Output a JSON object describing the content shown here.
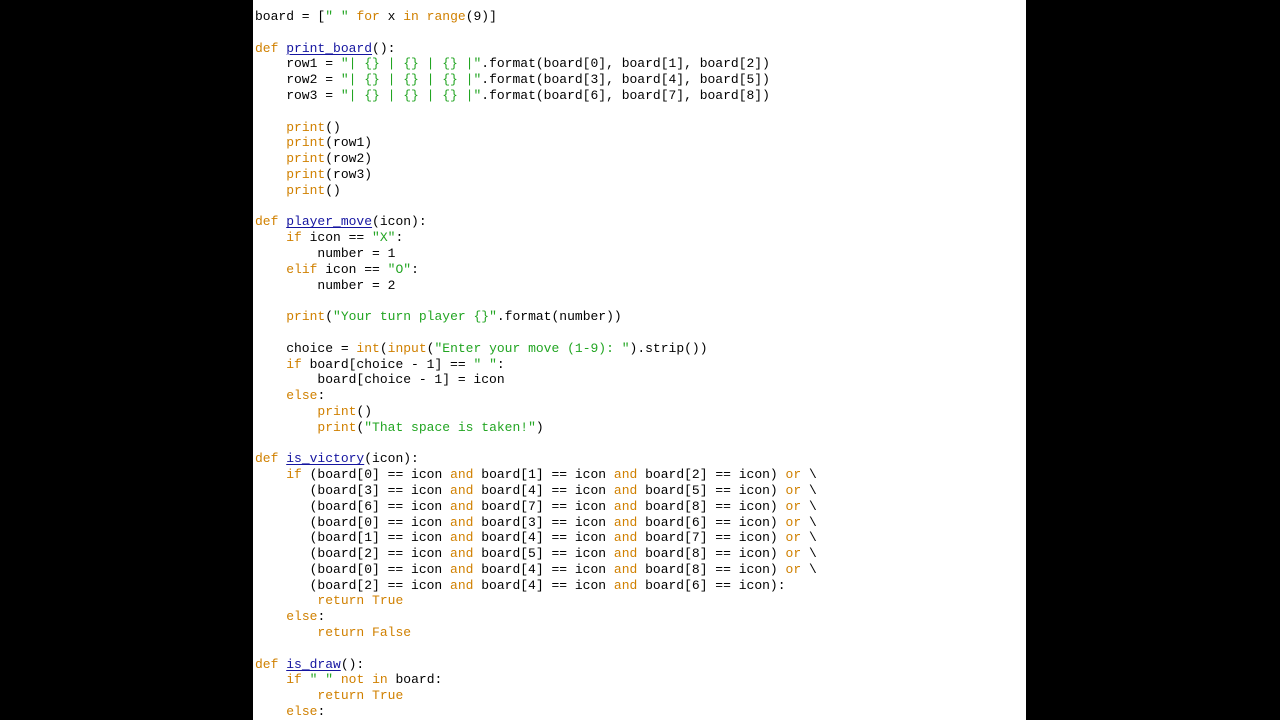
{
  "colors": {
    "background": "#000000",
    "editor_background": "#ffffff",
    "text": "#000000",
    "keyword": "#d08000",
    "string": "#22a522",
    "function_name": "#1515a0"
  },
  "editor": {
    "lines": [
      [
        {
          "t": "board = [",
          "c": "p"
        },
        {
          "t": "\" \"",
          "c": "s"
        },
        {
          "t": " ",
          "c": "p"
        },
        {
          "t": "for",
          "c": "k"
        },
        {
          "t": " x ",
          "c": "p"
        },
        {
          "t": "in",
          "c": "k"
        },
        {
          "t": " ",
          "c": "p"
        },
        {
          "t": "range",
          "c": "k"
        },
        {
          "t": "(9)]",
          "c": "p"
        }
      ],
      [],
      [
        {
          "t": "def",
          "c": "k"
        },
        {
          "t": " ",
          "c": "p"
        },
        {
          "t": "print_board",
          "c": "f"
        },
        {
          "t": "():",
          "c": "p"
        }
      ],
      [
        {
          "t": "    row1 = ",
          "c": "p"
        },
        {
          "t": "\"| {} | {} | {} |\"",
          "c": "s"
        },
        {
          "t": ".format(board[0], board[1], board[2])",
          "c": "p"
        }
      ],
      [
        {
          "t": "    row2 = ",
          "c": "p"
        },
        {
          "t": "\"| {} | {} | {} |\"",
          "c": "s"
        },
        {
          "t": ".format(board[3], board[4], board[5])",
          "c": "p"
        }
      ],
      [
        {
          "t": "    row3 = ",
          "c": "p"
        },
        {
          "t": "\"| {} | {} | {} |\"",
          "c": "s"
        },
        {
          "t": ".format(board[6], board[7], board[8])",
          "c": "p"
        }
      ],
      [],
      [
        {
          "t": "    ",
          "c": "p"
        },
        {
          "t": "print",
          "c": "k"
        },
        {
          "t": "()",
          "c": "p"
        }
      ],
      [
        {
          "t": "    ",
          "c": "p"
        },
        {
          "t": "print",
          "c": "k"
        },
        {
          "t": "(row1)",
          "c": "p"
        }
      ],
      [
        {
          "t": "    ",
          "c": "p"
        },
        {
          "t": "print",
          "c": "k"
        },
        {
          "t": "(row2)",
          "c": "p"
        }
      ],
      [
        {
          "t": "    ",
          "c": "p"
        },
        {
          "t": "print",
          "c": "k"
        },
        {
          "t": "(row3)",
          "c": "p"
        }
      ],
      [
        {
          "t": "    ",
          "c": "p"
        },
        {
          "t": "print",
          "c": "k"
        },
        {
          "t": "()",
          "c": "p"
        }
      ],
      [],
      [
        {
          "t": "def",
          "c": "k"
        },
        {
          "t": " ",
          "c": "p"
        },
        {
          "t": "player_move",
          "c": "f"
        },
        {
          "t": "(icon):",
          "c": "p"
        }
      ],
      [
        {
          "t": "    ",
          "c": "p"
        },
        {
          "t": "if",
          "c": "k"
        },
        {
          "t": " icon == ",
          "c": "p"
        },
        {
          "t": "\"X\"",
          "c": "s"
        },
        {
          "t": ":",
          "c": "p"
        }
      ],
      [
        {
          "t": "        number = 1",
          "c": "p"
        }
      ],
      [
        {
          "t": "    ",
          "c": "p"
        },
        {
          "t": "elif",
          "c": "k"
        },
        {
          "t": " icon == ",
          "c": "p"
        },
        {
          "t": "\"O\"",
          "c": "s"
        },
        {
          "t": ":",
          "c": "p"
        }
      ],
      [
        {
          "t": "        number = 2",
          "c": "p"
        }
      ],
      [],
      [
        {
          "t": "    ",
          "c": "p"
        },
        {
          "t": "print",
          "c": "k"
        },
        {
          "t": "(",
          "c": "p"
        },
        {
          "t": "\"Your turn player {}\"",
          "c": "s"
        },
        {
          "t": ".format(number))",
          "c": "p"
        }
      ],
      [],
      [
        {
          "t": "    choice = ",
          "c": "p"
        },
        {
          "t": "int",
          "c": "k"
        },
        {
          "t": "(",
          "c": "p"
        },
        {
          "t": "input",
          "c": "k"
        },
        {
          "t": "(",
          "c": "p"
        },
        {
          "t": "\"Enter your move (1-9): \"",
          "c": "s"
        },
        {
          "t": ").strip())",
          "c": "p"
        }
      ],
      [
        {
          "t": "    ",
          "c": "p"
        },
        {
          "t": "if",
          "c": "k"
        },
        {
          "t": " board[choice - 1] == ",
          "c": "p"
        },
        {
          "t": "\" \"",
          "c": "s"
        },
        {
          "t": ":",
          "c": "p"
        }
      ],
      [
        {
          "t": "        board[choice - 1] = icon",
          "c": "p"
        }
      ],
      [
        {
          "t": "    ",
          "c": "p"
        },
        {
          "t": "else",
          "c": "k"
        },
        {
          "t": ":",
          "c": "p"
        }
      ],
      [
        {
          "t": "        ",
          "c": "p"
        },
        {
          "t": "print",
          "c": "k"
        },
        {
          "t": "()",
          "c": "p"
        }
      ],
      [
        {
          "t": "        ",
          "c": "p"
        },
        {
          "t": "print",
          "c": "k"
        },
        {
          "t": "(",
          "c": "p"
        },
        {
          "t": "\"That space is taken!\"",
          "c": "s"
        },
        {
          "t": ")",
          "c": "p"
        }
      ],
      [],
      [
        {
          "t": "def",
          "c": "k"
        },
        {
          "t": " ",
          "c": "p"
        },
        {
          "t": "is_victory",
          "c": "f"
        },
        {
          "t": "(icon):",
          "c": "p"
        }
      ],
      [
        {
          "t": "    ",
          "c": "p"
        },
        {
          "t": "if",
          "c": "k"
        },
        {
          "t": " (board[0] == icon ",
          "c": "p"
        },
        {
          "t": "and",
          "c": "k"
        },
        {
          "t": " board[1] == icon ",
          "c": "p"
        },
        {
          "t": "and",
          "c": "k"
        },
        {
          "t": " board[2] == icon) ",
          "c": "p"
        },
        {
          "t": "or",
          "c": "k"
        },
        {
          "t": " \\",
          "c": "p"
        }
      ],
      [
        {
          "t": "       (board[3] == icon ",
          "c": "p"
        },
        {
          "t": "and",
          "c": "k"
        },
        {
          "t": " board[4] == icon ",
          "c": "p"
        },
        {
          "t": "and",
          "c": "k"
        },
        {
          "t": " board[5] == icon) ",
          "c": "p"
        },
        {
          "t": "or",
          "c": "k"
        },
        {
          "t": " \\",
          "c": "p"
        }
      ],
      [
        {
          "t": "       (board[6] == icon ",
          "c": "p"
        },
        {
          "t": "and",
          "c": "k"
        },
        {
          "t": " board[7] == icon ",
          "c": "p"
        },
        {
          "t": "and",
          "c": "k"
        },
        {
          "t": " board[8] == icon) ",
          "c": "p"
        },
        {
          "t": "or",
          "c": "k"
        },
        {
          "t": " \\",
          "c": "p"
        }
      ],
      [
        {
          "t": "       (board[0] == icon ",
          "c": "p"
        },
        {
          "t": "and",
          "c": "k"
        },
        {
          "t": " board[3] == icon ",
          "c": "p"
        },
        {
          "t": "and",
          "c": "k"
        },
        {
          "t": " board[6] == icon) ",
          "c": "p"
        },
        {
          "t": "or",
          "c": "k"
        },
        {
          "t": " \\",
          "c": "p"
        }
      ],
      [
        {
          "t": "       (board[1] == icon ",
          "c": "p"
        },
        {
          "t": "and",
          "c": "k"
        },
        {
          "t": " board[4] == icon ",
          "c": "p"
        },
        {
          "t": "and",
          "c": "k"
        },
        {
          "t": " board[7] == icon) ",
          "c": "p"
        },
        {
          "t": "or",
          "c": "k"
        },
        {
          "t": " \\",
          "c": "p"
        }
      ],
      [
        {
          "t": "       (board[2] == icon ",
          "c": "p"
        },
        {
          "t": "and",
          "c": "k"
        },
        {
          "t": " board[5] == icon ",
          "c": "p"
        },
        {
          "t": "and",
          "c": "k"
        },
        {
          "t": " board[8] == icon) ",
          "c": "p"
        },
        {
          "t": "or",
          "c": "k"
        },
        {
          "t": " \\",
          "c": "p"
        }
      ],
      [
        {
          "t": "       (board[0] == icon ",
          "c": "p"
        },
        {
          "t": "and",
          "c": "k"
        },
        {
          "t": " board[4] == icon ",
          "c": "p"
        },
        {
          "t": "and",
          "c": "k"
        },
        {
          "t": " board[8] == icon) ",
          "c": "p"
        },
        {
          "t": "or",
          "c": "k"
        },
        {
          "t": " \\",
          "c": "p"
        }
      ],
      [
        {
          "t": "       (board[2] == icon ",
          "c": "p"
        },
        {
          "t": "and",
          "c": "k"
        },
        {
          "t": " board[4] == icon ",
          "c": "p"
        },
        {
          "t": "and",
          "c": "k"
        },
        {
          "t": " board[6] == icon):",
          "c": "p"
        }
      ],
      [
        {
          "t": "        ",
          "c": "p"
        },
        {
          "t": "return",
          "c": "k"
        },
        {
          "t": " ",
          "c": "p"
        },
        {
          "t": "True",
          "c": "k"
        }
      ],
      [
        {
          "t": "    ",
          "c": "p"
        },
        {
          "t": "else",
          "c": "k"
        },
        {
          "t": ":",
          "c": "p"
        }
      ],
      [
        {
          "t": "        ",
          "c": "p"
        },
        {
          "t": "return",
          "c": "k"
        },
        {
          "t": " ",
          "c": "p"
        },
        {
          "t": "False",
          "c": "k"
        }
      ],
      [],
      [
        {
          "t": "def",
          "c": "k"
        },
        {
          "t": " ",
          "c": "p"
        },
        {
          "t": "is_draw",
          "c": "f"
        },
        {
          "t": "():",
          "c": "p"
        }
      ],
      [
        {
          "t": "    ",
          "c": "p"
        },
        {
          "t": "if",
          "c": "k"
        },
        {
          "t": " ",
          "c": "p"
        },
        {
          "t": "\" \"",
          "c": "s"
        },
        {
          "t": " ",
          "c": "p"
        },
        {
          "t": "not",
          "c": "k"
        },
        {
          "t": " ",
          "c": "p"
        },
        {
          "t": "in",
          "c": "k"
        },
        {
          "t": " board:",
          "c": "p"
        }
      ],
      [
        {
          "t": "        ",
          "c": "p"
        },
        {
          "t": "return",
          "c": "k"
        },
        {
          "t": " ",
          "c": "p"
        },
        {
          "t": "True",
          "c": "k"
        }
      ],
      [
        {
          "t": "    ",
          "c": "p"
        },
        {
          "t": "else",
          "c": "k"
        },
        {
          "t": ":",
          "c": "p"
        }
      ]
    ]
  }
}
